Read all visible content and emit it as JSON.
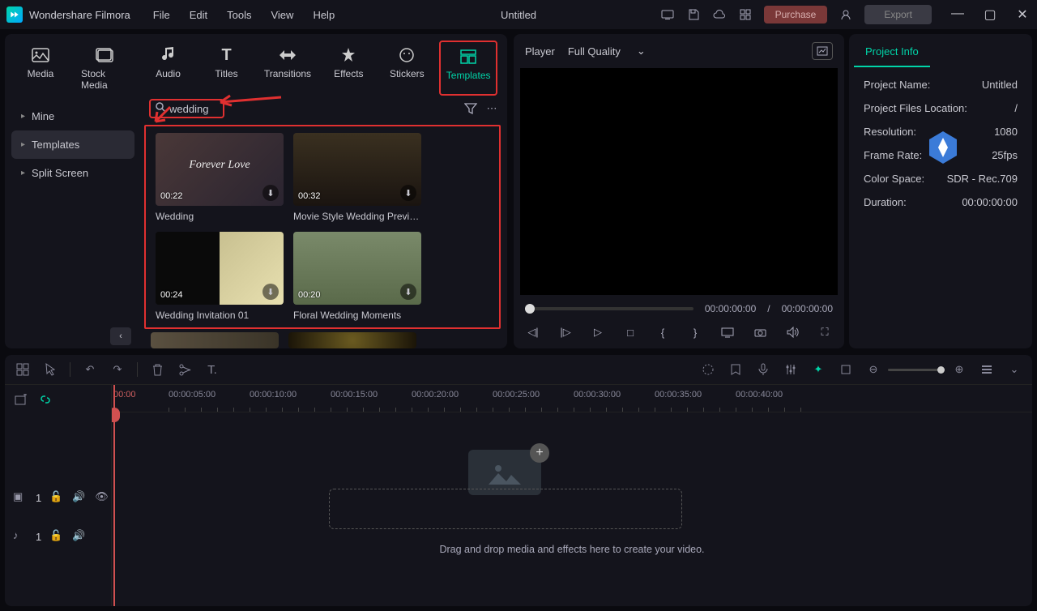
{
  "app": {
    "name": "Wondershare Filmora"
  },
  "menu": {
    "file": "File",
    "edit": "Edit",
    "tools": "Tools",
    "view": "View",
    "help": "Help"
  },
  "doc": {
    "title": "Untitled"
  },
  "title_actions": {
    "purchase": "Purchase",
    "export": "Export"
  },
  "tabs": {
    "media": "Media",
    "stock": "Stock Media",
    "audio": "Audio",
    "titles": "Titles",
    "transitions": "Transitions",
    "effects": "Effects",
    "stickers": "Stickers",
    "templates": "Templates"
  },
  "sidebar": {
    "mine": "Mine",
    "templates": "Templates",
    "split": "Split Screen"
  },
  "search": {
    "value": "wedding"
  },
  "templates_list": [
    {
      "title": "Wedding",
      "dur": "00:22"
    },
    {
      "title": "Movie Style Wedding Preview",
      "dur": "00:32"
    },
    {
      "title": "Wedding Invitation 01",
      "dur": "00:24"
    },
    {
      "title": "Floral Wedding Moments",
      "dur": "00:20"
    }
  ],
  "player": {
    "label": "Player",
    "quality": "Full Quality",
    "tc_current": "00:00:00:00",
    "tc_total": "00:00:00:00",
    "sep": "/"
  },
  "info": {
    "tab": "Project Info",
    "rows": {
      "name": {
        "k": "Project Name:",
        "v": "Untitled"
      },
      "loc": {
        "k": "Project Files Location:",
        "v": "/"
      },
      "res": {
        "k": "Resolution:",
        "v": "1080"
      },
      "fps": {
        "k": "Frame Rate:",
        "v": "25fps"
      },
      "cs": {
        "k": "Color Space:",
        "v": "SDR - Rec.709"
      },
      "dur": {
        "k": "Duration:",
        "v": "00:00:00:00"
      }
    }
  },
  "timeline": {
    "start": "00:00",
    "ticks": [
      "00:00:05:00",
      "00:00:10:00",
      "00:00:15:00",
      "00:00:20:00",
      "00:00:25:00",
      "00:00:30:00",
      "00:00:35:00",
      "00:00:40:00"
    ],
    "drop_text": "Drag and drop media and effects here to create your video.",
    "track_video": "1",
    "track_audio": "1"
  }
}
